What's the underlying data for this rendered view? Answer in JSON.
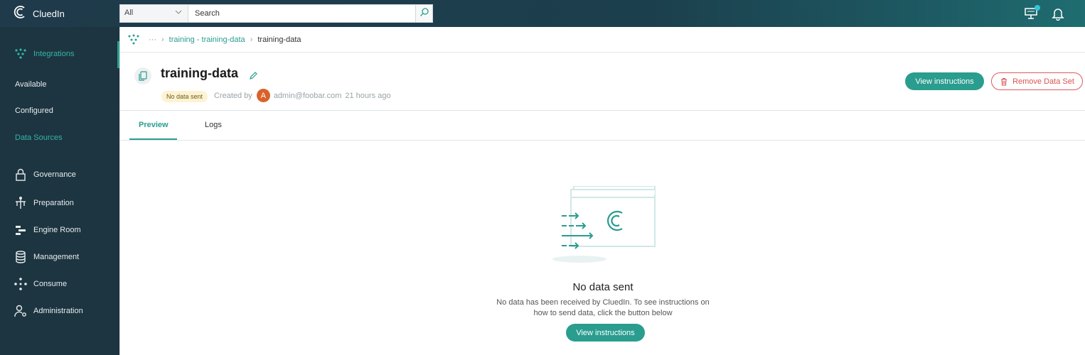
{
  "app": {
    "name": "CluedIn"
  },
  "search": {
    "scope": "All",
    "placeholder": "Search"
  },
  "sidebar": {
    "section": "Integrations",
    "subitems": [
      "Available",
      "Configured",
      "Data Sources"
    ],
    "items": [
      "Governance",
      "Preparation",
      "Engine Room",
      "Management",
      "Consume",
      "Administration"
    ]
  },
  "breadcrumb": {
    "ellipsis": "···",
    "parent": "training - training-data",
    "current": "training-data"
  },
  "dataset": {
    "title": "training-data",
    "status": "No data sent",
    "created_by_label": "Created by",
    "avatar_letter": "A",
    "author": "admin@foobar.com",
    "time": "21 hours ago"
  },
  "actions": {
    "view_instructions": "View instructions",
    "remove": "Remove Data Set"
  },
  "tabs": [
    "Preview",
    "Logs"
  ],
  "empty_state": {
    "title": "No data sent",
    "line1": "No data has been received by CluedIn. To see instructions on",
    "line2": "how to send data, click the button below",
    "button": "View instructions"
  },
  "colors": {
    "accent": "#2a9d8f",
    "sidebar": "#1d3540",
    "danger": "#d9534f",
    "badge_bg": "#fdf3d2"
  }
}
